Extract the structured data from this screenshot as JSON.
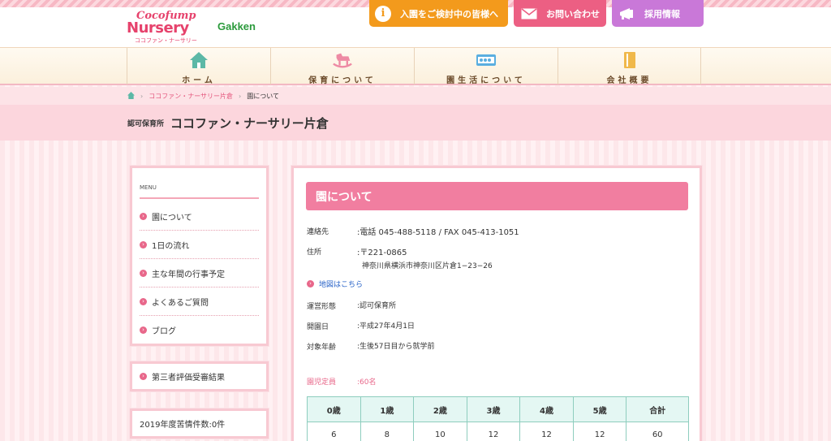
{
  "header": {
    "logo": {
      "line1": "Cocofump",
      "line2": "Nursery",
      "line3": "ココファン・ナーサリー"
    },
    "partner_logo": "Gakken",
    "buttons": {
      "admission": "入園をご検討中の皆様へ",
      "contact": "お問い合わせ",
      "recruit": "採用情報"
    }
  },
  "nav": {
    "items": [
      {
        "label": "ホーム",
        "icon": "home-icon"
      },
      {
        "label": "保育について",
        "icon": "rocking-horse-icon"
      },
      {
        "label": "園生活について",
        "icon": "abacus-icon"
      },
      {
        "label": "会社概要",
        "icon": "notebook-icon"
      }
    ]
  },
  "breadcrumb": {
    "home_icon": "home-icon",
    "items": [
      "ココファン・ナーサリー片倉",
      "園について"
    ]
  },
  "page_title": {
    "kind": "認可保育所",
    "name": "ココファン・ナーサリー片倉"
  },
  "sidebar": {
    "menu_heading": "MENU",
    "items": [
      "園について",
      "1日の流れ",
      "主な年間の行事予定",
      "よくあるご質問",
      "ブログ"
    ],
    "evaluation": "第三者評価受審結果",
    "complaints": "2019年度苦情件数:0件"
  },
  "main": {
    "title": "園について",
    "contact_label": "連絡先",
    "contact_value": ":電話 045-488-5118 / FAX 045-413-1051",
    "address_label": "住所",
    "address_zip": ":〒221-0865",
    "address_line": "神奈川県横浜市神奈川区片倉1−23−26",
    "map_link": "地図はこちら",
    "operation_label": "運営形態",
    "operation_value": ":認可保育所",
    "opening_label": "開園日",
    "opening_value": ":平成27年4月1日",
    "age_label": "対象年齢",
    "age_value": ":生後57日目から就学前",
    "capacity_label": "園児定員",
    "capacity_value": ":60名",
    "table": {
      "headers": [
        "0歳",
        "1歳",
        "2歳",
        "3歳",
        "4歳",
        "5歳",
        "合計"
      ],
      "values": [
        "6",
        "8",
        "10",
        "12",
        "12",
        "12",
        "60"
      ]
    }
  },
  "colors": {
    "accent_pink": "#f17ea0",
    "orange": "#f39a1c",
    "purple": "#c978d8",
    "teal": "#8ecdbe"
  }
}
